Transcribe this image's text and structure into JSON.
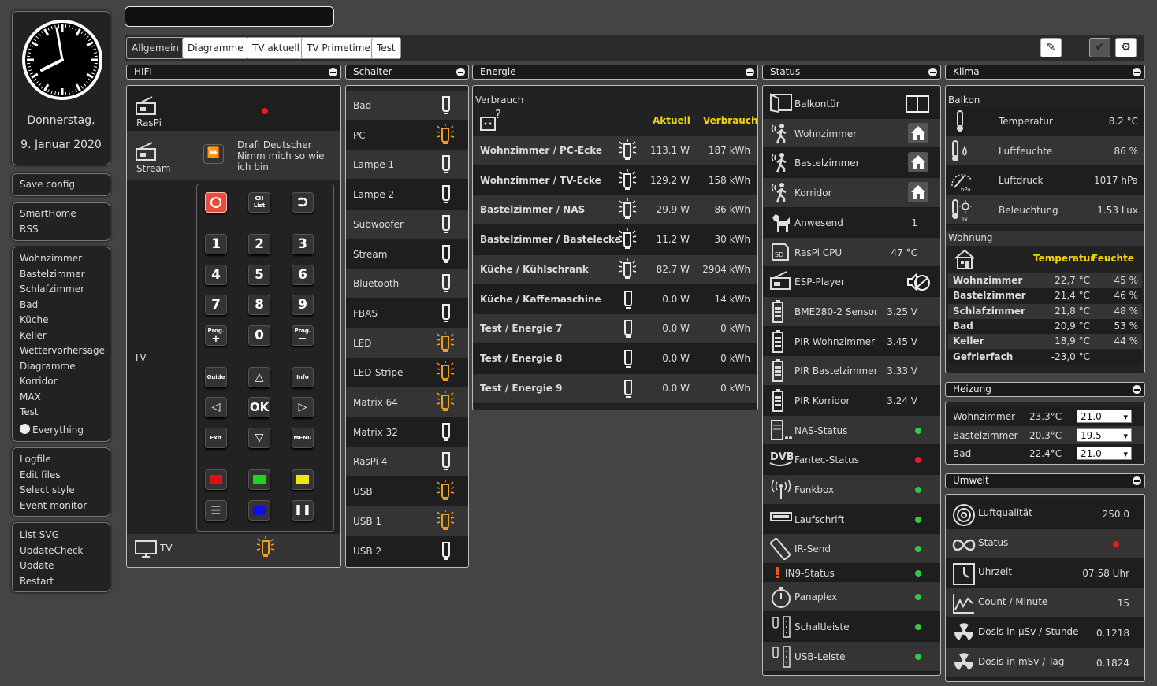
{
  "clock": {
    "day": "Donnerstag,",
    "date": "9. Januar 2020"
  },
  "topInput": "",
  "sidebar": {
    "save": "Save config",
    "group1": [
      "SmartHome",
      "RSS"
    ],
    "rooms": [
      "Wohnzimmer",
      "Bastelzimmer",
      "Schlafzimmer",
      "Bad",
      "Küche",
      "Keller",
      "Wettervorhersage",
      "Diagramme",
      "Korridor",
      "MAX",
      "Test"
    ],
    "everything": "Everything",
    "group3": [
      "Logfile",
      "Edit files",
      "Select style",
      "Event monitor"
    ],
    "group4": [
      "List SVG",
      "UpdateCheck",
      "Update",
      "Restart"
    ]
  },
  "tabs": [
    "Allgemein",
    "Diagramme",
    "TV aktuell",
    "TV Primetime",
    "Test"
  ],
  "hifi": {
    "title": "HIFI",
    "raspi": "RasPi",
    "stream": "Stream",
    "song": "Drafi Deutscher\nNimm mich so wie ich bin",
    "tv": "TV",
    "tv2": "TV",
    "keys": [
      "1",
      "2",
      "3",
      "4",
      "5",
      "6",
      "7",
      "8",
      "9",
      "0",
      "OK"
    ],
    "small": {
      "ch": "CH",
      "list": "List",
      "prog": "Prog.",
      "guide": "Guide",
      "info": "Info",
      "exit": "Exit",
      "menu": "MENU"
    }
  },
  "schalter": {
    "title": "Schalter",
    "items": [
      {
        "name": "Bad",
        "on": false
      },
      {
        "name": "PC",
        "on": true
      },
      {
        "name": "Lampe 1",
        "on": false
      },
      {
        "name": "Lampe 2",
        "on": false
      },
      {
        "name": "Subwoofer",
        "on": false
      },
      {
        "name": "Stream",
        "on": false
      },
      {
        "name": "Bluetooth",
        "on": false
      },
      {
        "name": "FBAS",
        "on": false
      },
      {
        "name": "LED",
        "on": true
      },
      {
        "name": "LED-Stripe",
        "on": true
      },
      {
        "name": "Matrix 64",
        "on": true
      },
      {
        "name": "Matrix 32",
        "on": false
      },
      {
        "name": "RasPi 4",
        "on": false
      },
      {
        "name": "USB",
        "on": true
      },
      {
        "name": "USB 1",
        "on": true
      },
      {
        "name": "USB 2",
        "on": false
      }
    ]
  },
  "energie": {
    "title": "Energie",
    "verbrauch": "Verbrauch",
    "h_aktuell": "Aktuell",
    "h_verbrauch": "Verbrauch",
    "rows": [
      {
        "name": "Wohnzimmer / PC-Ecke",
        "akt": "113.1 W",
        "ver": "187 kWh",
        "on": true
      },
      {
        "name": "Wohnzimmer / TV-Ecke",
        "akt": "129.2 W",
        "ver": "158 kWh",
        "on": true
      },
      {
        "name": "Bastelzimmer / NAS",
        "akt": "29.9 W",
        "ver": "86 kWh",
        "on": true
      },
      {
        "name": "Bastelzimmer / Bastelecke",
        "akt": "11.2 W",
        "ver": "30 kWh",
        "on": true
      },
      {
        "name": "Küche / Kühlschrank",
        "akt": "82.7 W",
        "ver": "2904 kWh",
        "on": true
      },
      {
        "name": "Küche / Kaffemaschine",
        "akt": "0.0 W",
        "ver": "14 kWh",
        "on": false
      },
      {
        "name": "Test / Energie 7",
        "akt": "0.0 W",
        "ver": "0 kWh",
        "on": false
      },
      {
        "name": "Test / Energie 8",
        "akt": "0.0 W",
        "ver": "0 kWh",
        "on": false
      },
      {
        "name": "Test / Energie 9",
        "akt": "0.0 W",
        "ver": "0 kWh",
        "on": false
      }
    ]
  },
  "status": {
    "title": "Status",
    "rows": [
      {
        "name": "Balkontür",
        "val": "",
        "kind": "window"
      },
      {
        "name": "Wohnzimmer",
        "val": "",
        "kind": "home"
      },
      {
        "name": "Bastelzimmer",
        "val": "",
        "kind": "home"
      },
      {
        "name": "Korridor",
        "val": "",
        "kind": "home"
      },
      {
        "name": "Anwesend",
        "val": "1",
        "kind": "text"
      },
      {
        "name": "RasPi CPU",
        "val": "47 °C",
        "kind": "text"
      },
      {
        "name": "ESP-Player",
        "val": "",
        "kind": "mute"
      },
      {
        "name": "BME280-2 Sensor",
        "val": "3.25 V",
        "kind": "text"
      },
      {
        "name": "PIR Wohnzimmer",
        "val": "3.45 V",
        "kind": "text"
      },
      {
        "name": "PIR Bastelzimmer",
        "val": "3.33 V",
        "kind": "text"
      },
      {
        "name": "PIR Korridor",
        "val": "3.24 V",
        "kind": "text"
      },
      {
        "name": "NAS-Status",
        "val": "",
        "kind": "green"
      },
      {
        "name": "Fantec-Status",
        "val": "",
        "kind": "red"
      },
      {
        "name": "Funkbox",
        "val": "",
        "kind": "green"
      },
      {
        "name": "Laufschrift",
        "val": "",
        "kind": "green"
      },
      {
        "name": "IR-Send",
        "val": "",
        "kind": "green"
      },
      {
        "name": "IN9-Status",
        "val": "",
        "kind": "green"
      },
      {
        "name": "Panaplex",
        "val": "",
        "kind": "green"
      },
      {
        "name": "Schaltleiste",
        "val": "",
        "kind": "green"
      },
      {
        "name": "USB-Leiste",
        "val": "",
        "kind": "green"
      }
    ]
  },
  "klima": {
    "title": "Klima",
    "balkon": "Balkon",
    "rows": [
      {
        "name": "Temperatur",
        "val": "8.2 °C"
      },
      {
        "name": "Luftfeuchte",
        "val": "86 %"
      },
      {
        "name": "Luftdruck",
        "val": "1017 hPa"
      },
      {
        "name": "Beleuchtung",
        "val": "1.53 Lux"
      }
    ],
    "wohnung": "Wohnung",
    "h_temp": "Temperatur",
    "h_feuchte": "Feuchte",
    "hPa": "hPa",
    "lx": "lx",
    "table": [
      {
        "n": "Wohnzimmer",
        "t": "22,7 °C",
        "f": "45 %"
      },
      {
        "n": "Bastelzimmer",
        "t": "21,4 °C",
        "f": "46 %"
      },
      {
        "n": "Schlafzimmer",
        "t": "21,8 °C",
        "f": "48 %"
      },
      {
        "n": "Bad",
        "t": "20,9 °C",
        "f": "53 %"
      },
      {
        "n": "Keller",
        "t": "18,9 °C",
        "f": "44 %"
      },
      {
        "n": "Gefrierfach",
        "t": "-23,0 °C",
        "f": ""
      }
    ]
  },
  "heizung": {
    "title": "Heizung",
    "rows": [
      {
        "n": "Wohnzimmer",
        "t": "23.3°C",
        "s": "21.0"
      },
      {
        "n": "Bastelzimmer",
        "t": "20.3°C",
        "s": "19.5"
      },
      {
        "n": "Bad",
        "t": "22.4°C",
        "s": "21.0"
      }
    ]
  },
  "umwelt": {
    "title": "Umwelt",
    "rows": [
      {
        "n": "Luftqualität",
        "v": "250.0"
      },
      {
        "n": "Status",
        "v": ""
      },
      {
        "n": "Uhrzeit",
        "v": "07:58 Uhr"
      },
      {
        "n": "Count / Minute",
        "v": "15"
      },
      {
        "n": "Dosis in µSv / Stunde",
        "v": "0.1218"
      },
      {
        "n": "Dosis in mSv / Tag",
        "v": "0.1824"
      }
    ]
  }
}
